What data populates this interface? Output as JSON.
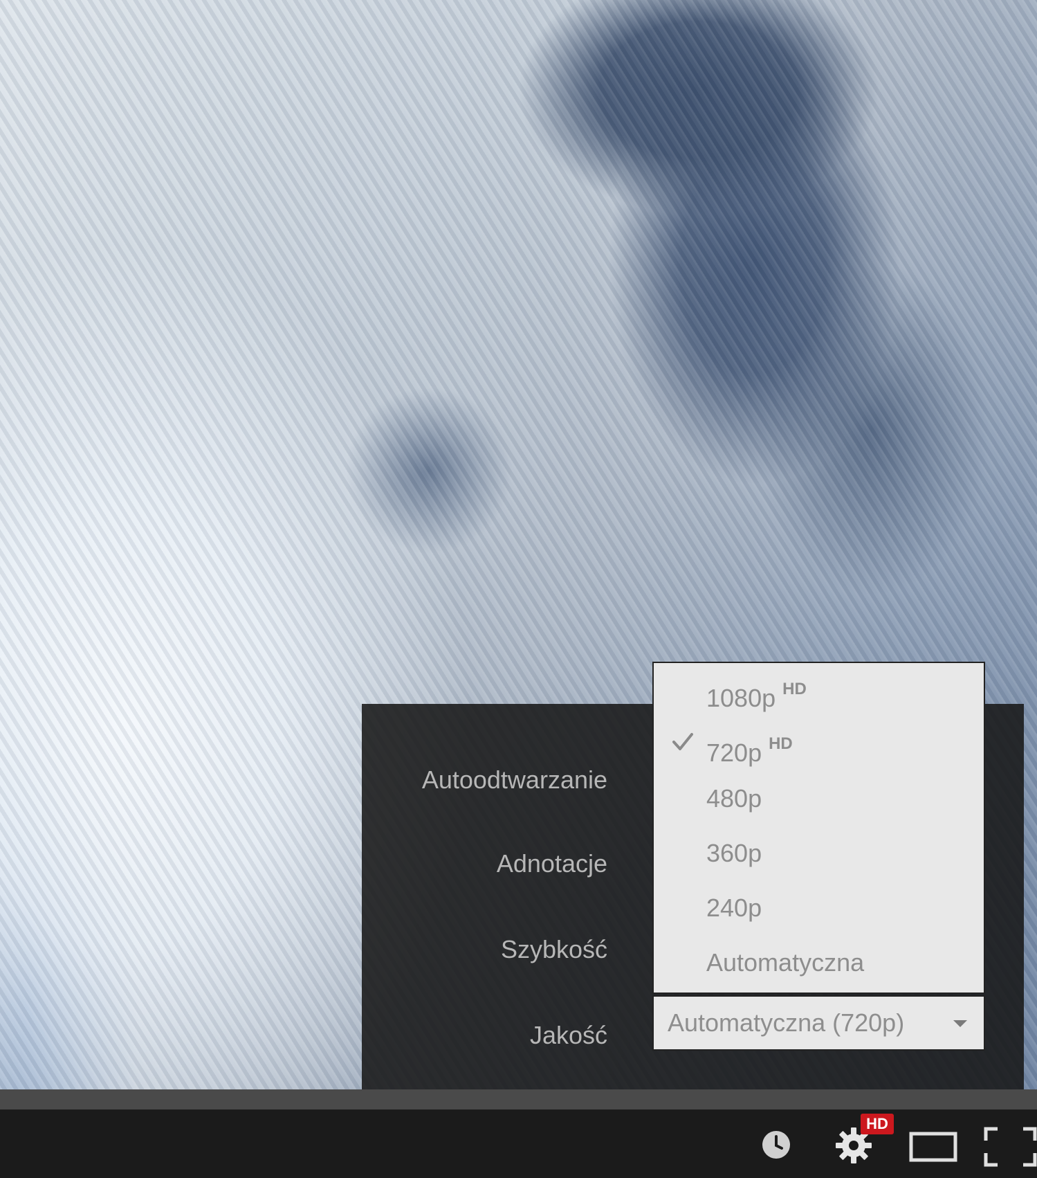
{
  "settings": {
    "labels": {
      "autoplay": "Autoodtwarzanie",
      "annotations": "Adnotacje",
      "speed": "Szybkość",
      "quality": "Jakość"
    },
    "quality_select": {
      "value": "Automatyczna (720p)"
    },
    "quality_options": [
      {
        "label": "1080p",
        "badge": "HD",
        "selected": false
      },
      {
        "label": "720p",
        "badge": "HD",
        "selected": true
      },
      {
        "label": "480p",
        "badge": "",
        "selected": false
      },
      {
        "label": "360p",
        "badge": "",
        "selected": false
      },
      {
        "label": "240p",
        "badge": "",
        "selected": false
      },
      {
        "label": "Automatyczna",
        "badge": "",
        "selected": false
      }
    ]
  },
  "controls": {
    "settings_badge": "HD",
    "icons": [
      "watch-later-icon",
      "settings-gear-icon",
      "theater-mode-icon",
      "fullscreen-icon"
    ]
  },
  "colors": {
    "panel_bg": "#181818",
    "dropdown_bg": "#e8e8e8",
    "hd_badge": "#cc181e",
    "control_bar": "#1b1b1b"
  }
}
